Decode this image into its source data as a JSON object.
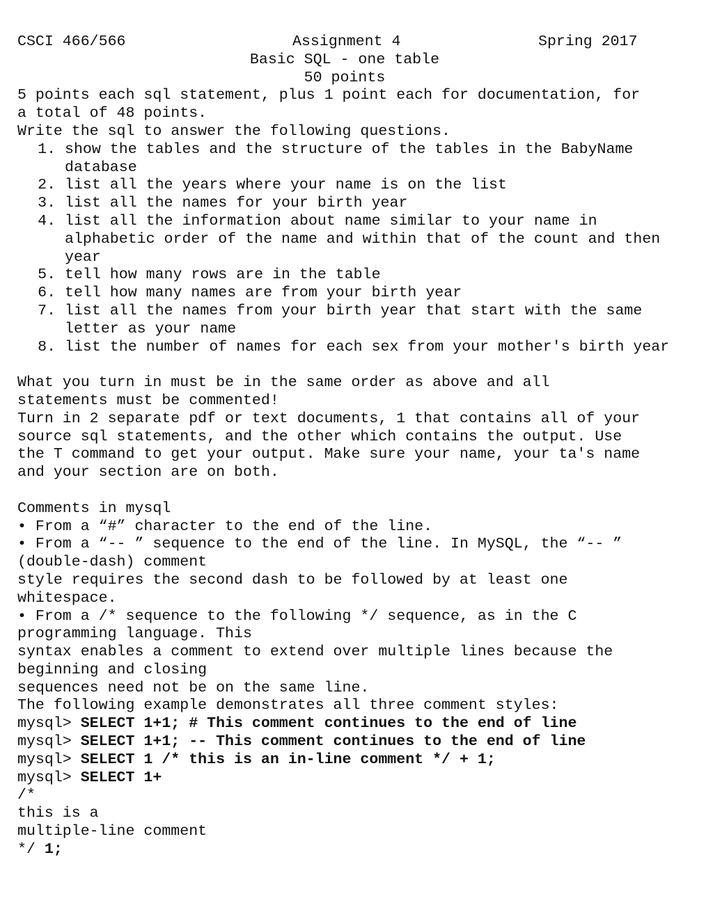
{
  "header": {
    "course": "CSCI 466/566",
    "assignment": "Assignment 4",
    "term": "Spring 2017",
    "subtitle": "Basic SQL - one table",
    "points": "50 points"
  },
  "intro": {
    "line1": "5 points each sql statement, plus 1 point each for documentation, for",
    "line2": "a total of 48 points.",
    "line3": "Write the sql to answer the following questions."
  },
  "questions": [
    {
      "num": "1.",
      "text": "show the tables and the structure of the tables in the BabyName database"
    },
    {
      "num": "2.",
      "text": "list all the years where your name is on the list"
    },
    {
      "num": "3.",
      "text": "list all the names for your birth year"
    },
    {
      "num": "4.",
      "text": "list all the information about name similar to your name in alphabetic order of the name and within that of the count and then year"
    },
    {
      "num": "5.",
      "text": "tell how many rows are in the table"
    },
    {
      "num": "6.",
      "text": "tell how many names are from your birth year"
    },
    {
      "num": "7.",
      "text": "list all the names from your birth year that start with the same letter as your name"
    },
    {
      "num": "8.",
      "text": "list the number of names for each sex from your mother's birth year"
    }
  ],
  "turn_in": {
    "line1": "What you turn in must be in the same order as above and all",
    "line2": "statements must be commented!",
    "line3": "Turn in 2 separate pdf or text documents, 1 that contains all of your",
    "line4": "source sql statements, and the other which contains the output. Use",
    "line5": "the T command to get your output. Make sure your name, your ta's name",
    "line6": "and your section are on both."
  },
  "comments": {
    "heading": "Comments in mysql",
    "b1": "• From a “#” character to the end of the line.",
    "b2_1": "• From a “-- ” sequence to the end of the line. In MySQL, the “-- ”",
    "b2_2": "(double-dash) comment",
    "b2_3": "style requires the second dash to be followed by at least one",
    "b2_4": "whitespace.",
    "b3_1": "• From a /* sequence to the following */ sequence, as in the C",
    "b3_2": "programming language. This",
    "b3_3": "syntax enables a comment to extend over multiple lines because the",
    "b3_4": "beginning and closing",
    "b3_5": "sequences need not be on the same line.",
    "example_intro": "The following example demonstrates all three comment styles:"
  },
  "examples": {
    "prompt": "mysql> ",
    "ex1": "SELECT 1+1; # This comment continues to the end of line",
    "ex2": "SELECT 1+1; -- This comment continues to the end of line",
    "ex3": "SELECT 1 /* this is an in-line comment */ + 1;",
    "ex4": "SELECT 1+",
    "ml1": "/*",
    "ml2": "this is a",
    "ml3": "multiple-line comment",
    "ml4": "*/ ",
    "ml4_bold": "1;"
  }
}
